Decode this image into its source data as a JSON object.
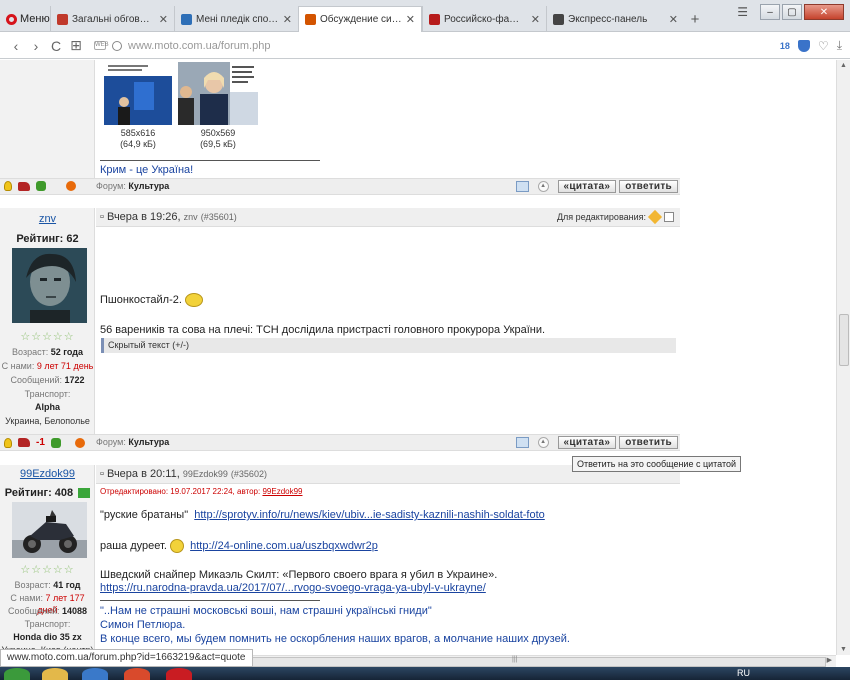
{
  "browser": {
    "menu_label": "Меню",
    "tabs": [
      {
        "title": "Загальні обговорення - ",
        "favicon_color": "#c0392b"
      },
      {
        "title": "Мені пледік сподобався",
        "favicon_color": "#2e6fb7"
      },
      {
        "title": "Обсуждение ситуации в",
        "favicon_color": "#d35400",
        "active": true
      },
      {
        "title": "Российско-фашистская о",
        "favicon_color": "#b71c1c"
      },
      {
        "title": "Экспресс-панель",
        "favicon_color": "#444444"
      }
    ],
    "address": "www.moto.com.ua/forum.php",
    "badge_count": "18",
    "status_url": "www.moto.com.ua/forum.php?id=1663219&act=quote"
  },
  "post1": {
    "images": [
      {
        "caption1": "585x616",
        "caption2": "(64,9 кБ)"
      },
      {
        "caption1": "950x569",
        "caption2": "(69,5 кБ)"
      }
    ],
    "signature": "Крим - це Україна!",
    "forum_label": "Форум:",
    "forum_name": "Культура"
  },
  "post2": {
    "username": "znv",
    "rating": "Рейтинг: 62",
    "date": "Вчера в 19:26,",
    "author": "znv",
    "post_id": "(#35601)",
    "edit_label": "Для редактирования:",
    "stars": "☆☆☆☆☆",
    "age_label": "Возраст:",
    "age_value": "52 года",
    "since_label": "С нами:",
    "since_value": "9 лет 71 день",
    "messages_label": "Сообщений:",
    "messages_value": "1722",
    "transport_label": "Транспорт:",
    "transport_value": "Alpha",
    "location": "Украина, Белополье",
    "text1": "Пшонкостайл-2.",
    "text2": "56 вареників та сова на плечі: ТСН дослідила пристрасті головного прокурора України.",
    "hidden_text": "Скрытый текст (+/-)",
    "karma": "-1",
    "forum_label": "Форум:",
    "forum_name": "Культура",
    "tooltip": "Ответить на это сообщение с цитатой"
  },
  "post3": {
    "username": "99Ezdok99",
    "rating": "Рейтинг: 408",
    "date": "Вчера в 20:11,",
    "author": "99Ezdok99",
    "post_id": "(#35602)",
    "edited_prefix": "Отредактировано: 19.07.2017 22:24, автор:",
    "edited_author": "99Ezdok99",
    "stars": "☆☆☆☆☆",
    "age_label": "Возраст:",
    "age_value": "41 год",
    "since_label": "С нами:",
    "since_value": "7 лет 177 дней",
    "messages_label": "Сообщений:",
    "messages_value": "14088",
    "transport_label": "Транспорт:",
    "transport_value": "Honda dio 35 zx",
    "location": "Украина, Киев (центр)",
    "line1_text": "\"руские братаны\"",
    "line1_link": "http://sprotyv.info/ru/news/kiev/ubiv...ie-sadisty-kaznili-nashih-soldat-foto",
    "line2_text": "раша дуреет.",
    "line2_link": "http://24-online.com.ua/uszbqxwdwr2p",
    "line3_text": "Шведский снайпер Микаэль Скилт: «Первого своего врага я убил в Украине».",
    "line3_link": "https://ru.narodna-pravda.ua/2017/07/...rvogo-svoego-vraga-ya-ubyl-v-ukrayne/",
    "quote1": "\"..Нам не страшні московські воші, нам страшні українські гниди\"",
    "quote2": "Симон Петлюра.",
    "quote3": "В конце всего, мы будем помнить не оскорбления наших врагов, а молчание наших друзей."
  },
  "buttons": {
    "quote": "«цитата»",
    "reply": "ответить"
  },
  "taskbar": {
    "tray_lang": "RU"
  }
}
